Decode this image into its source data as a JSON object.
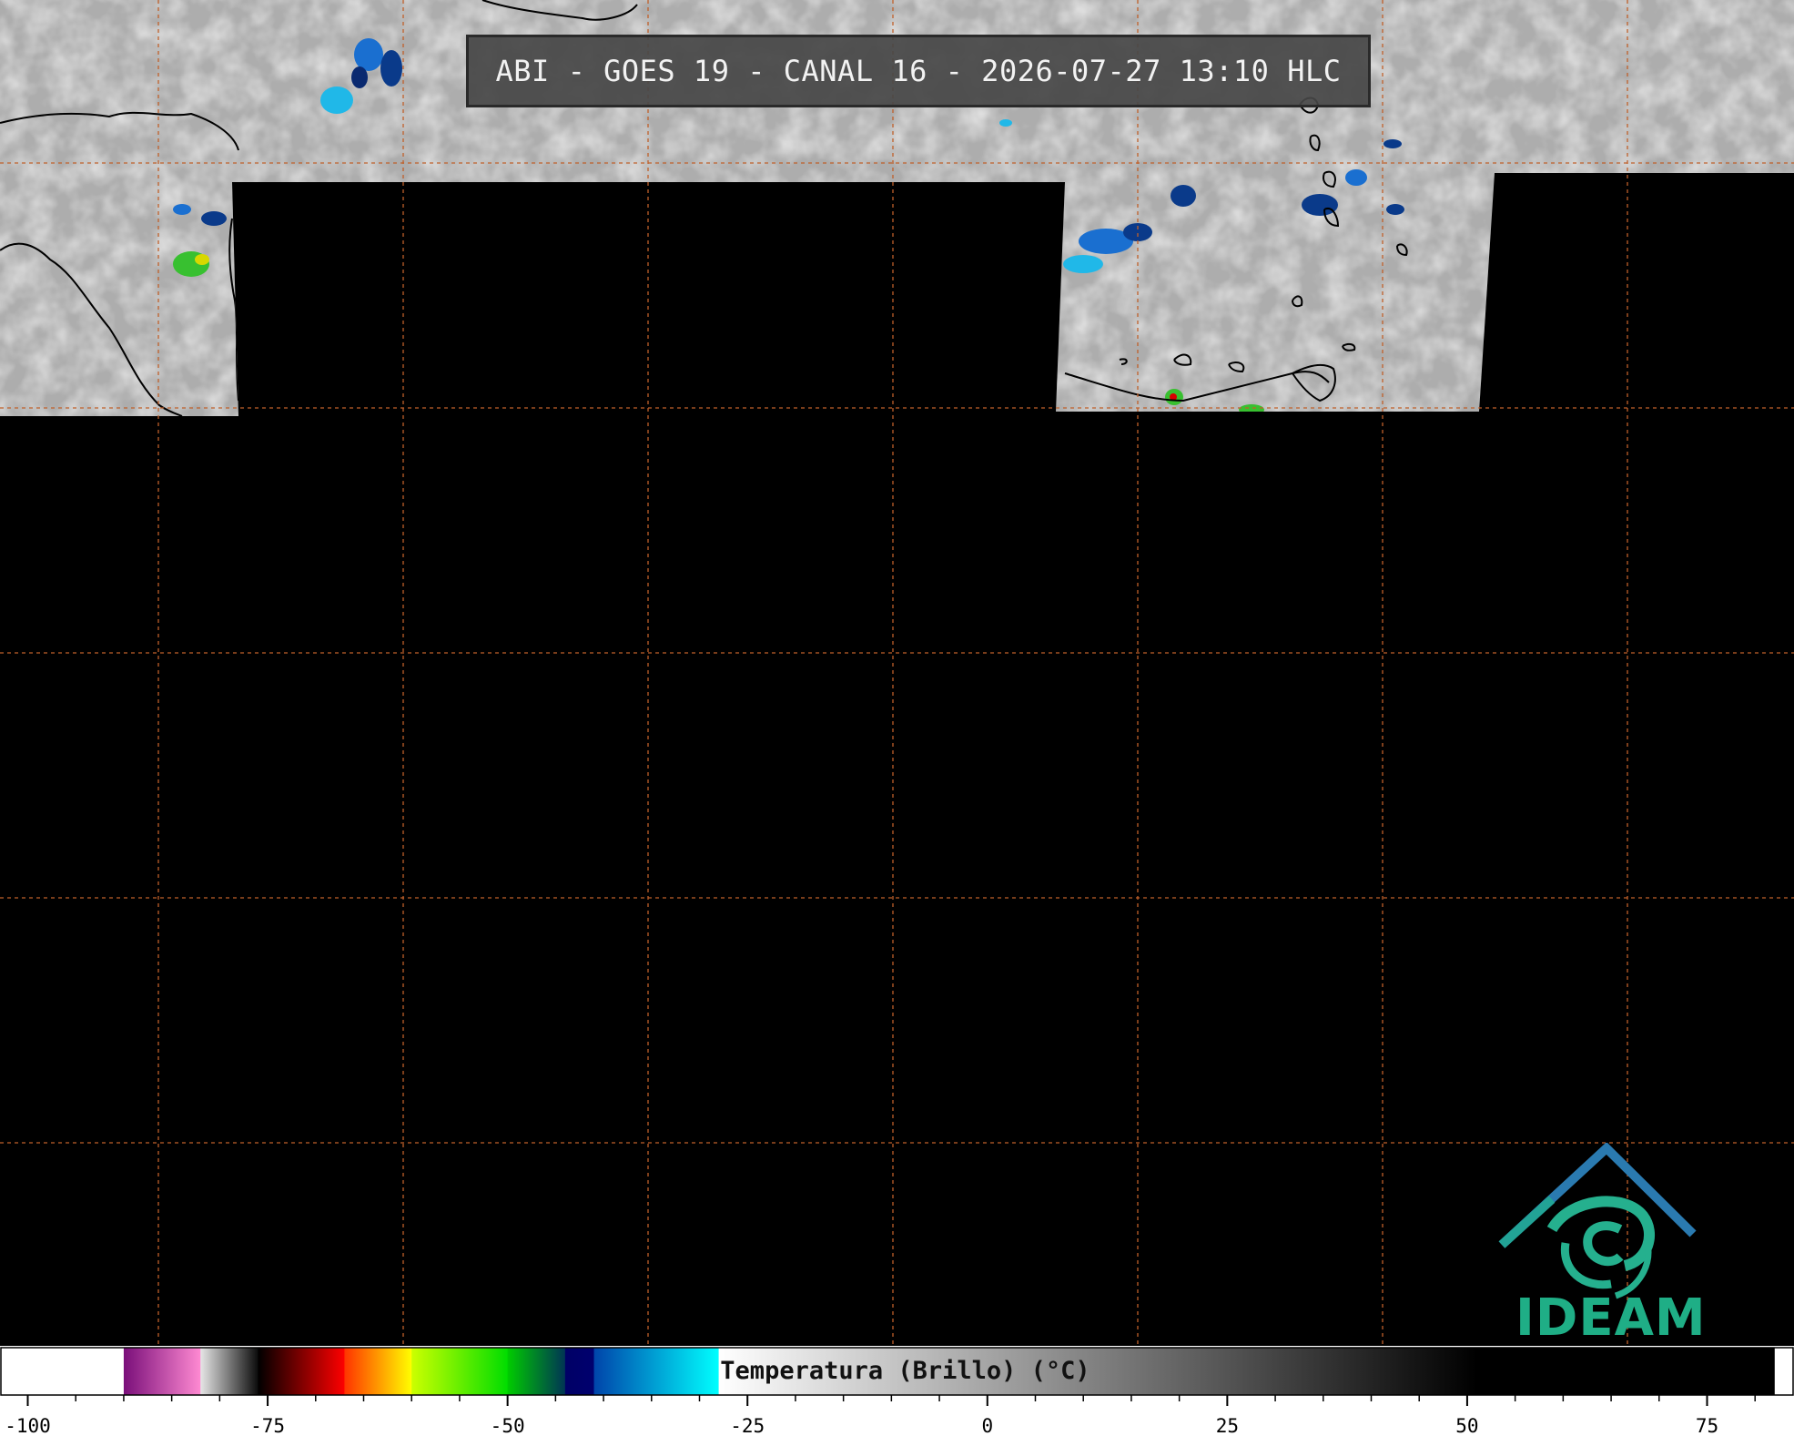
{
  "title": "ABI - GOES 19 - CANAL 16 - 2026-07-27 13:10 HLC",
  "colorbar": {
    "label": "Temperatura (Brillo) (°C)",
    "min": -105,
    "max": 82,
    "ticks": [
      "-100",
      "-75",
      "-50",
      "-25",
      "0",
      "25",
      "50",
      "75"
    ],
    "tick_values": [
      -100,
      -75,
      -50,
      -25,
      0,
      25,
      50,
      75
    ],
    "segments": [
      {
        "from": -105,
        "to": -90,
        "colors": [
          "#ffffff",
          "#ffffff"
        ]
      },
      {
        "from": -90,
        "to": -82,
        "colors": [
          "#7a0f7a",
          "#ff8ad2"
        ]
      },
      {
        "from": -82,
        "to": -76,
        "colors": [
          "#e6e6e6",
          "#0a0a0a"
        ]
      },
      {
        "from": -76,
        "to": -67,
        "colors": [
          "#000000",
          "#ff0000"
        ]
      },
      {
        "from": -67,
        "to": -60,
        "colors": [
          "#ff3300",
          "#ffff00"
        ]
      },
      {
        "from": -60,
        "to": -50,
        "colors": [
          "#ccff00",
          "#00dd00"
        ]
      },
      {
        "from": -50,
        "to": -44,
        "colors": [
          "#00cc00",
          "#003355"
        ]
      },
      {
        "from": -44,
        "to": -41,
        "colors": [
          "#000066",
          "#00006e"
        ]
      },
      {
        "from": -41,
        "to": -28,
        "colors": [
          "#0044aa",
          "#00ffff"
        ]
      },
      {
        "from": -28,
        "to": 51,
        "colors": [
          "#ffffff",
          "#000000"
        ]
      },
      {
        "from": 51,
        "to": 82,
        "colors": [
          "#000000",
          "#000000"
        ]
      }
    ]
  },
  "logo": {
    "name": "IDEAM",
    "colors": {
      "roof": "#2a7ab0",
      "swirl": "#25b08e",
      "text": "#1fae86"
    }
  },
  "map": {
    "background": "#000000",
    "grid_color": "#c0602a",
    "cloud_color": "#b5b5b5",
    "coast_color": "#000000"
  }
}
